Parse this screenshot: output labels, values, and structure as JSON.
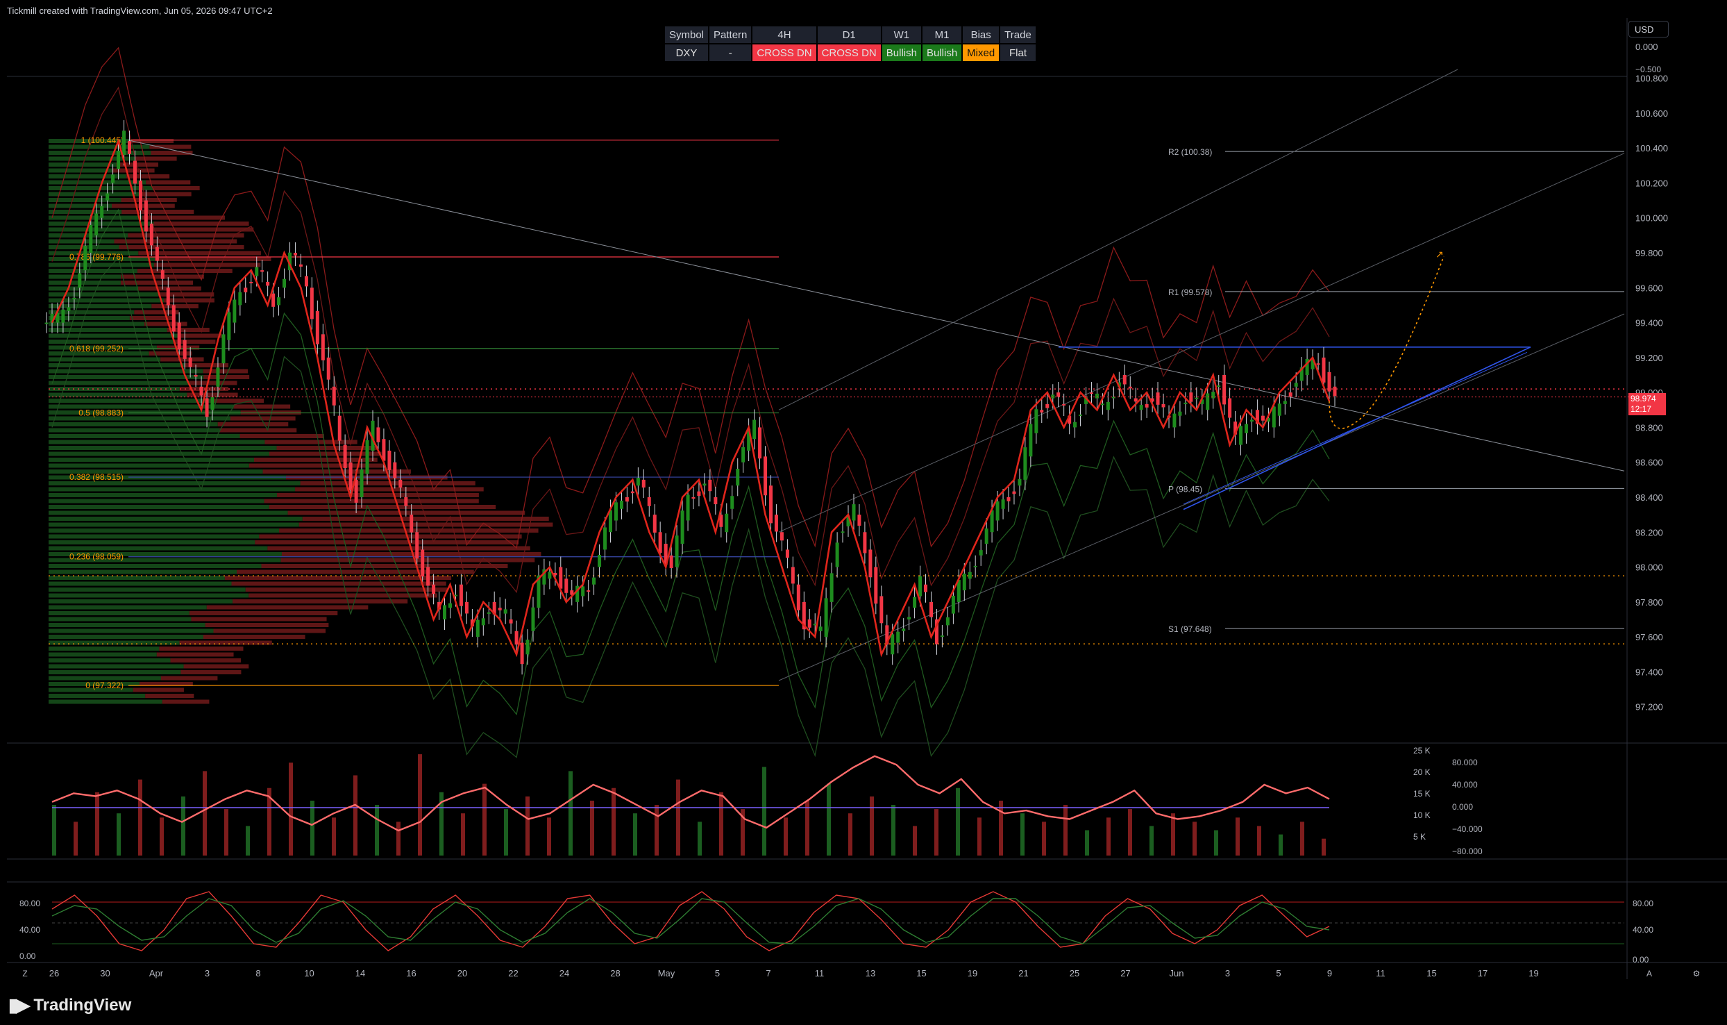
{
  "header": {
    "caption": "Tickmill created with TradingView.com, Jun 05, 2026 09:47 UTC+2"
  },
  "brand": {
    "name": "TradingView"
  },
  "status_table": {
    "headers": [
      "Symbol",
      "Pattern",
      "4H",
      "D1",
      "W1",
      "M1",
      "Bias",
      "Trade"
    ],
    "values": [
      "DXY",
      "-",
      "CROSS DN",
      "CROSS DN",
      "Bullish",
      "Bullish",
      "Mixed",
      "Flat"
    ],
    "value_colors": [
      "#1e222d",
      "#1e222d",
      "#f23645",
      "#f23645",
      "#1b7a1b",
      "#1b7a1b",
      "#ff9800",
      "#1e222d"
    ]
  },
  "currency_selector": {
    "label": "USD"
  },
  "last_price": {
    "value": "98.974",
    "countdown": "12:17"
  },
  "colors": {
    "bull": "#26a69a",
    "bull_candle": "#1e8c1e",
    "bear_candle": "#f23645",
    "fib": "#ff9800",
    "channel": "#2f54eb"
  },
  "chart_data": [
    {
      "type": "candlestick",
      "title": "",
      "ylim": [
        97.0,
        100.85
      ],
      "y_ticks": [
        "100.800",
        "100.600",
        "100.400",
        "100.200",
        "100.000",
        "99.800",
        "99.600",
        "99.400",
        "99.200",
        "99.000",
        "98.800",
        "98.600",
        "98.400",
        "98.200",
        "98.000",
        "97.800",
        "97.600",
        "97.400",
        "97.200"
      ],
      "x_ticks": [
        "26",
        "30",
        "Apr",
        "3",
        "8",
        "10",
        "14",
        "16",
        "20",
        "22",
        "24",
        "28",
        "May",
        "5",
        "7",
        "11",
        "13",
        "15",
        "19",
        "21",
        "25",
        "27",
        "Jun",
        "3",
        "5",
        "9",
        "11",
        "15",
        "17",
        "19"
      ],
      "price_path": [
        99.4,
        99.6,
        99.9,
        100.2,
        100.44,
        100.1,
        99.7,
        99.4,
        99.1,
        98.9,
        99.3,
        99.6,
        99.7,
        99.5,
        99.8,
        99.6,
        99.2,
        98.7,
        98.4,
        98.8,
        98.6,
        98.3,
        98.0,
        97.7,
        97.9,
        97.6,
        97.8,
        97.7,
        97.5,
        97.9,
        98.0,
        97.8,
        97.9,
        98.2,
        98.4,
        98.5,
        98.2,
        98.0,
        98.4,
        98.5,
        98.2,
        98.6,
        98.8,
        98.3,
        98.0,
        97.7,
        97.6,
        98.2,
        98.3,
        98.0,
        97.5,
        97.7,
        97.9,
        97.6,
        97.8,
        98.0,
        98.2,
        98.4,
        98.5,
        98.9,
        99.0,
        98.8,
        99.0,
        98.9,
        99.1,
        98.9,
        99.0,
        98.8,
        99.0,
        98.9,
        99.1,
        98.7,
        98.9,
        98.8,
        99.0,
        99.1,
        99.2,
        98.95
      ],
      "fib_levels": [
        {
          "label": "1 (100.445)",
          "value": 100.445
        },
        {
          "label": "0.786 (99.776)",
          "value": 99.776
        },
        {
          "label": "0.618 (99.252)",
          "value": 99.252
        },
        {
          "label": "0.5 (98.883)",
          "value": 98.883
        },
        {
          "label": "0.382 (98.515)",
          "value": 98.515
        },
        {
          "label": "0.236 (98.059)",
          "value": 98.059
        },
        {
          "label": "0 (97.322)",
          "value": 97.322
        }
      ],
      "pivot_levels": [
        {
          "label": "R2 (100.38)",
          "value": 100.38
        },
        {
          "label": "R1 (99.578)",
          "value": 99.578
        },
        {
          "label": "P (98.45)",
          "value": 98.45
        },
        {
          "label": "S1 (97.648)",
          "value": 97.648
        }
      ],
      "dotted_levels": [
        99.02,
        97.95,
        97.56
      ]
    },
    {
      "type": "bar",
      "title": "",
      "y_ticks_left": [
        "25 K",
        "20 K",
        "15 K",
        "10 K",
        "5 K"
      ],
      "y_ticks_right": [
        "80.000",
        "40.000",
        "0.000",
        "−40.000",
        "−80.000"
      ],
      "oscillator": [
        10,
        25,
        20,
        30,
        15,
        -10,
        -25,
        -5,
        15,
        30,
        20,
        -15,
        -30,
        -10,
        5,
        -20,
        -40,
        -25,
        10,
        25,
        35,
        5,
        -20,
        -10,
        15,
        40,
        25,
        5,
        -15,
        10,
        30,
        20,
        -20,
        -35,
        -10,
        15,
        45,
        70,
        90,
        75,
        40,
        25,
        50,
        10,
        -10,
        -5,
        -15,
        -20,
        -5,
        10,
        30,
        -10,
        -20,
        -15,
        -5,
        10,
        40,
        25,
        35,
        15
      ],
      "volume": [
        12,
        8,
        15,
        10,
        18,
        9,
        14,
        20,
        11,
        7,
        16,
        22,
        13,
        9,
        19,
        12,
        8,
        24,
        15,
        10,
        17,
        11,
        14,
        9,
        20,
        13,
        16,
        10,
        12,
        18,
        8,
        15,
        11,
        21,
        9,
        13,
        17,
        10,
        14,
        12,
        7,
        11,
        16,
        9,
        13,
        10,
        8,
        12,
        6,
        9,
        11,
        7,
        10,
        8,
        6,
        9,
        7,
        5,
        8,
        4
      ]
    },
    {
      "type": "line",
      "title": "",
      "ylim": [
        0,
        100
      ],
      "y_ticks_left": [
        "80.00",
        "40.00",
        "0.00"
      ],
      "y_ticks_right": [
        "80.00",
        "40.00",
        "0.00"
      ],
      "stoch_k": [
        70,
        90,
        60,
        20,
        10,
        40,
        85,
        95,
        60,
        20,
        15,
        50,
        90,
        80,
        40,
        10,
        30,
        70,
        90,
        60,
        25,
        15,
        45,
        85,
        90,
        50,
        20,
        30,
        75,
        95,
        70,
        30,
        10,
        25,
        65,
        90,
        85,
        55,
        20,
        15,
        40,
        80,
        95,
        80,
        45,
        15,
        20,
        60,
        85,
        70,
        35,
        20,
        40,
        75,
        90,
        60,
        30,
        45
      ],
      "stoch_d": [
        60,
        75,
        70,
        45,
        25,
        30,
        60,
        85,
        75,
        40,
        22,
        35,
        70,
        82,
        60,
        30,
        25,
        55,
        80,
        70,
        40,
        22,
        35,
        65,
        85,
        65,
        35,
        28,
        55,
        85,
        80,
        50,
        22,
        20,
        45,
        75,
        85,
        70,
        40,
        22,
        30,
        60,
        85,
        85,
        60,
        30,
        20,
        45,
        72,
        75,
        50,
        28,
        32,
        60,
        80,
        70,
        45,
        40
      ]
    }
  ]
}
